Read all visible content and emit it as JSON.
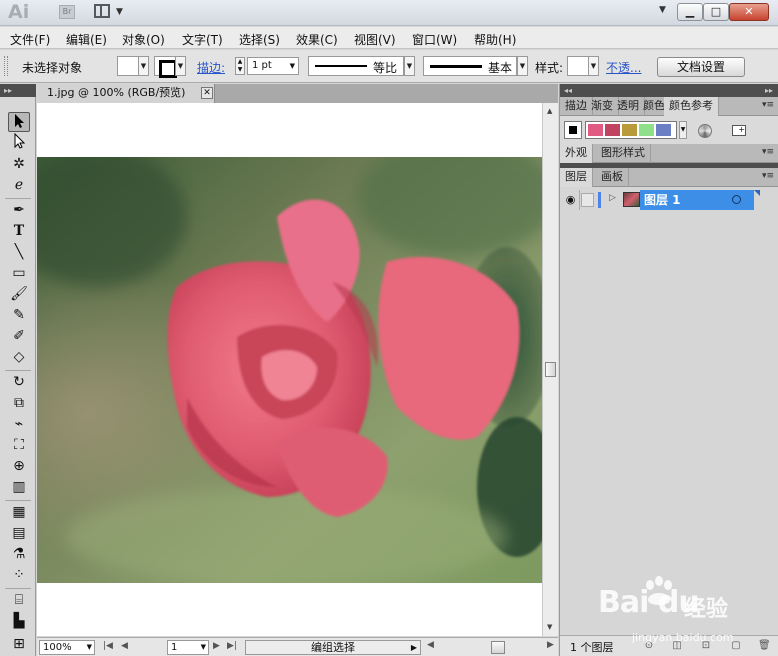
{
  "app": {
    "logo_text": "Ai",
    "bridge_badge": "Br"
  },
  "window_controls": {
    "minimize": "▁",
    "maximize": "□",
    "close": "✕"
  },
  "menu": [
    {
      "label": "文件(F)"
    },
    {
      "label": "编辑(E)"
    },
    {
      "label": "对象(O)"
    },
    {
      "label": "文字(T)"
    },
    {
      "label": "选择(S)"
    },
    {
      "label": "效果(C)"
    },
    {
      "label": "视图(V)"
    },
    {
      "label": "窗口(W)"
    },
    {
      "label": "帮助(H)"
    }
  ],
  "control_bar": {
    "selection_status": "未选择对象",
    "stroke_label": "描边:",
    "stroke_width": "1 pt",
    "stroke_profile": "等比",
    "brush_definition": "基本",
    "style_label": "样式:",
    "opacity_link": "不透...",
    "doc_setup_button": "文档设置"
  },
  "document": {
    "tab_title": "1.jpg @ 100% (RGB/预览)",
    "tab_close": "✕"
  },
  "status_bar": {
    "zoom": "100%",
    "page": "1",
    "info": "编组选择"
  },
  "panels": {
    "top_tabs": [
      {
        "label": "描边"
      },
      {
        "label": "渐变"
      },
      {
        "label": "透明"
      },
      {
        "label": "颜色"
      },
      {
        "label": "颜色参考"
      }
    ],
    "active_top_tab": "颜色参考",
    "harmony_colors": [
      "#e05a82",
      "#c0435f",
      "#b99a3a",
      "#8fe08a",
      "#6b7fc4"
    ],
    "mid_tabs": [
      {
        "label": "外观"
      },
      {
        "label": "图形样式"
      }
    ],
    "layer_tabs": [
      {
        "label": "图层"
      },
      {
        "label": "画板"
      }
    ],
    "layer_name": "图层 1",
    "layers_count": "1 个图层"
  },
  "watermark": {
    "logo_text": "Bai du",
    "jingyan": "经验",
    "url": "jingyan.baidu.com"
  }
}
